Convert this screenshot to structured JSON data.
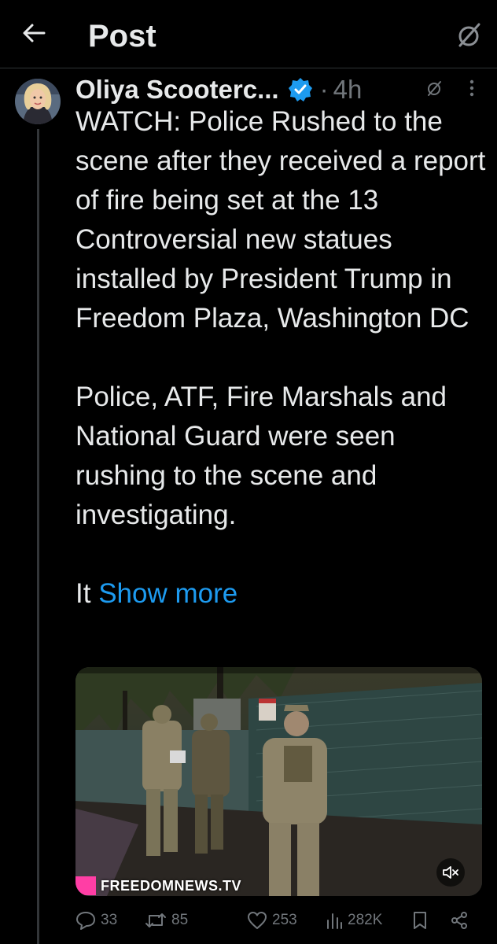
{
  "header": {
    "title": "Post",
    "back_icon": "arrow-left-icon",
    "grok_icon": "grok-slash-circle-icon"
  },
  "post": {
    "author_name": "Oliya Scooterc...",
    "verified": true,
    "separator": "·",
    "time": "4h",
    "paragraph1": "WATCH: Police Rushed to the scene after they received a report of fire being set at the 13 Controversial new statues installed by President Trump in Freedom Plaza, Washington DC",
    "paragraph2": "Police, ATF, Fire Marshals and National Guard were seen rushing to the scene and investigating.",
    "truncated_prefix": "It",
    "show_more": "Show more"
  },
  "media": {
    "watermark": "FREEDOMNEWS.TV",
    "mute_icon": "speaker-muted-icon"
  },
  "actions": {
    "replies": "33",
    "reposts": "85",
    "likes": "253",
    "views": "282K"
  },
  "colors": {
    "background": "#000000",
    "text": "#e7e9ea",
    "muted": "#71767b",
    "accent": "#1d9bf0",
    "divider": "#2f3336"
  }
}
